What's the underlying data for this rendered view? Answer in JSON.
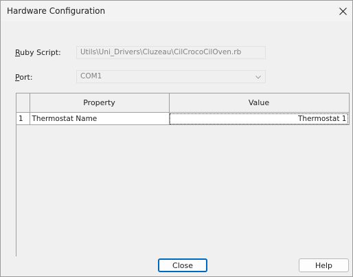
{
  "window": {
    "title": "Hardware Configuration",
    "close_icon": "close-icon"
  },
  "form": {
    "ruby_script": {
      "label_accel": "R",
      "label_rest": "uby Script:",
      "value": "Utils\\Uni_Drivers\\Cluzeau\\CilCrocoCilOven.rb"
    },
    "port": {
      "label_accel": "P",
      "label_rest": "ort:",
      "value": "COM1",
      "dropdown_icon": "chevron-down-icon"
    }
  },
  "grid": {
    "columns": [
      "Property",
      "Value"
    ],
    "rows": [
      {
        "index": "1",
        "property": "Thermostat Name",
        "value": "Thermostat 1"
      }
    ]
  },
  "buttons": {
    "close": "Close",
    "help": "Help"
  },
  "colors": {
    "dialog_bg": "#f0f0f0",
    "default_button_border": "#0067c0",
    "grid_border": "#a0a0a0"
  }
}
